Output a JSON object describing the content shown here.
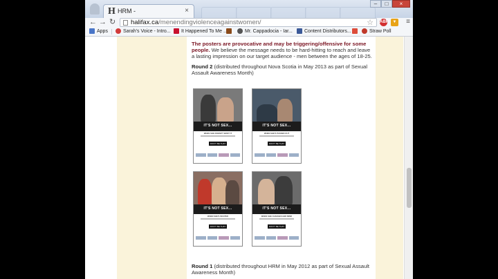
{
  "browser": {
    "tab_title": "HRM -",
    "tab_favicon": "H",
    "tab_close": "×",
    "url_host": "halifax.ca",
    "url_path": "/menendingviolenceagainstwomen/",
    "extensions": [
      "ABP",
      "security-shield-icon"
    ],
    "window_controls": {
      "minimize": "–",
      "maximize": "□",
      "close": "×"
    }
  },
  "bookmarks": [
    {
      "label": "Apps",
      "icon": "apps-grid-icon",
      "color": "#4a76c8"
    },
    {
      "label": "Sarah's Voice - Intro...",
      "icon": "heart-icon",
      "color": "#d23a3a"
    },
    {
      "label": "It Happened To Me ...",
      "icon": "xojane-icon",
      "color": "#c8102e"
    },
    {
      "label": "Mr. Cappadocia - lar...",
      "icon": "ribbon-icon",
      "color": "#8a4a1a"
    },
    {
      "label": "Mr. Cappadocia - Iar...",
      "icon": "c-icon",
      "color": "#555555"
    },
    {
      "label": "Content Distributors...",
      "icon": "facebook-icon",
      "color": "#3b5998"
    },
    {
      "label": "",
      "icon": "google-plus-icon",
      "color": "#dd4b39"
    },
    {
      "label": "Straw Poll",
      "icon": "straw-poll-icon",
      "color": "#c0392b"
    }
  ],
  "content": {
    "intro_strong": "The posters are provocative and may be triggering/offensive for some people.",
    "intro_rest": " We believe the message needs to be hard-hitting to reach and leave a lasting impression on our target audience - men between the ages of 18-25.",
    "round2_label": "Round 2",
    "round2_text": " (distributed throughout Nova Scotia in May 2013 as part of Sexual Assault Awareness Month)",
    "round1_label": "Round 1",
    "round1_text": " (distributed throughout HRM in May 2012 as part of Sexual Assault Awareness Month)"
  },
  "posters": [
    {
      "headline": "IT'S NOT SEX...",
      "subline": "WHEN SHE DOESN'T WANT IT",
      "brand": "DON'T BE THAT GUY"
    },
    {
      "headline": "IT'S NOT SEX...",
      "subline": "WHEN SHE'S PASSED OUT",
      "brand": "DON'T BE THAT GUY"
    },
    {
      "headline": "IT'S NOT SEX...",
      "subline": "WHEN SHE'S WASTED",
      "brand": "DON'T BE THAT GUY"
    },
    {
      "headline": "IT'S NOT SEX...",
      "subline": "WHEN SHE CHANGES HER MIND",
      "brand": "DON'T BE THAT GUY"
    }
  ],
  "colors": {
    "accent_warning": "#7a1422",
    "side_panel": "#faf3da",
    "chrome": "#dfe7f2"
  }
}
